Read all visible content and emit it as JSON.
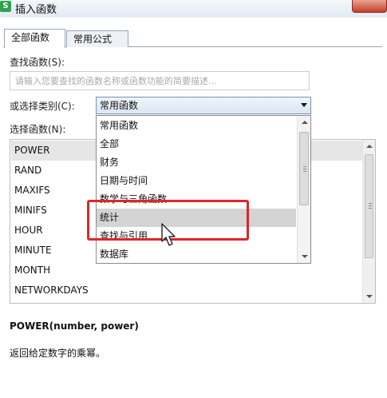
{
  "window": {
    "title": "插入函数",
    "app_icon": "S"
  },
  "tabs": [
    {
      "label": "全部函数",
      "active": true
    },
    {
      "label": "常用公式",
      "active": false
    }
  ],
  "search": {
    "label": "查找函数(S):",
    "placeholder": "请输入您要查找的函数名称或函数功能的简要描述..."
  },
  "category": {
    "label": "或选择类别(C):",
    "selected": "常用函数",
    "options": [
      "常用函数",
      "全部",
      "财务",
      "日期与时间",
      "数学与三角函数",
      "统计",
      "查找与引用",
      "数据库"
    ],
    "highlighted": "统计"
  },
  "functions": {
    "label": "选择函数(N):",
    "items": [
      "POWER",
      "RAND",
      "MAXIFS",
      "MINIFS",
      "HOUR",
      "MINUTE",
      "MONTH",
      "NETWORKDAYS"
    ],
    "selected": "POWER"
  },
  "details": {
    "signature": "POWER(number, power)",
    "description": "返回给定数字的乘幂。"
  },
  "colors": {
    "highlight_frame": "#e0252a",
    "selection": "#e6e6e6"
  }
}
